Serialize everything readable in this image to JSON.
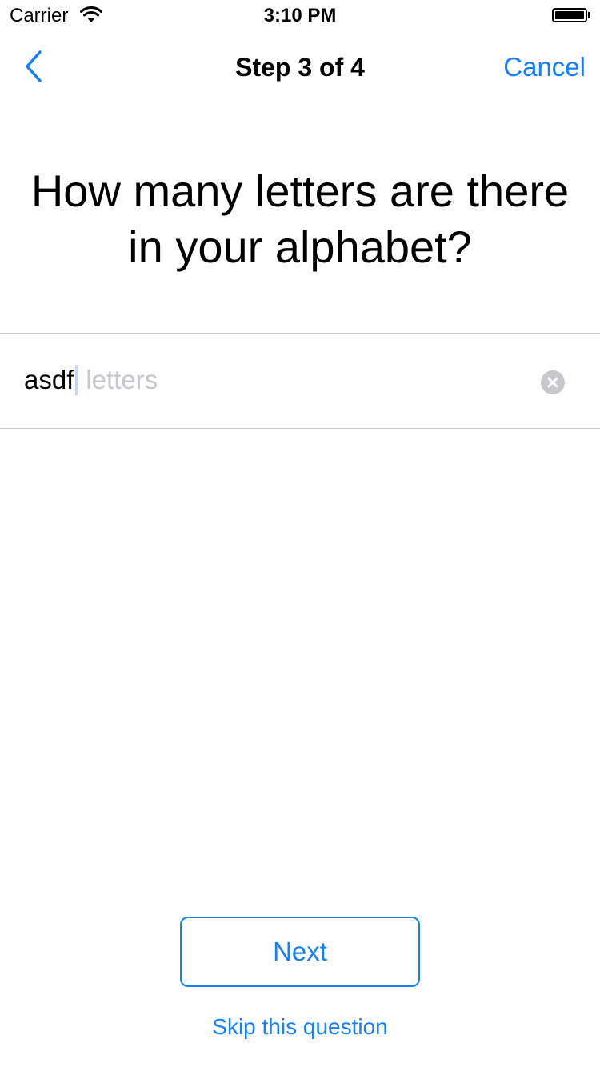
{
  "status_bar": {
    "carrier": "Carrier",
    "time": "3:10 PM",
    "wifi_icon": "wifi-icon",
    "battery_icon": "battery-icon"
  },
  "nav": {
    "back_icon": "chevron-left-icon",
    "title": "Step 3 of 4",
    "cancel_label": "Cancel"
  },
  "question": {
    "text": "How many letters are there in your alphabet?"
  },
  "answer": {
    "value": "asdf",
    "unit_placeholder": "letters",
    "clear_icon": "clear-circle-icon"
  },
  "footer": {
    "next_label": "Next",
    "skip_label": "Skip this question"
  },
  "colors": {
    "accent": "#147efb",
    "placeholder": "#c7c7cd",
    "separator": "#c8c7cc"
  }
}
